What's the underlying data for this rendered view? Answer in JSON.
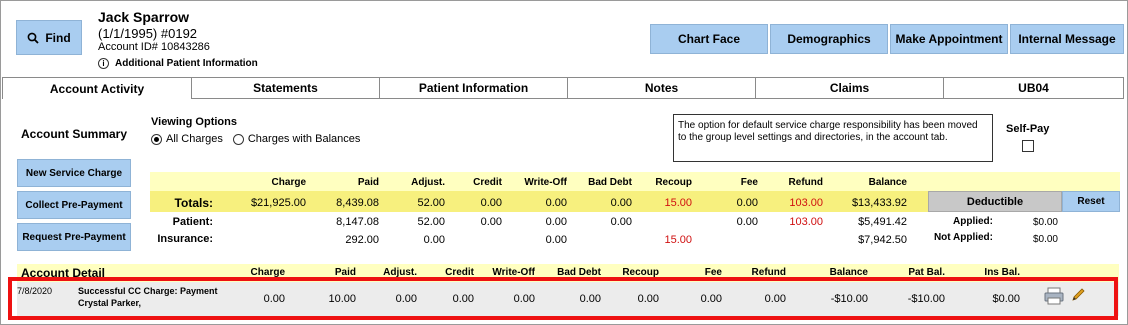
{
  "header": {
    "find_label": "Find",
    "patient_name": "Jack Sparrow",
    "patient_dob": "(1/1/1995) #0192",
    "account_id": "Account ID# 10843286",
    "additional_info": "Additional Patient Information",
    "buttons": [
      "Chart Face",
      "Demographics",
      "Make Appointment",
      "Internal Message"
    ]
  },
  "tabs": [
    "Account Activity",
    "Statements",
    "Patient Information",
    "Notes",
    "Claims",
    "UB04"
  ],
  "summary": {
    "title": "Account Summary",
    "viewing_options": "Viewing Options",
    "radio_all": "All Charges",
    "radio_balances": "Charges with Balances",
    "notice": "The option for default service charge responsibility has been moved to the group level settings and directories, in the account tab.",
    "self_pay": "Self-Pay",
    "side_buttons": [
      "New Service Charge",
      "Collect Pre-Payment",
      "Request Pre-Payment"
    ],
    "columns": [
      "Charge",
      "Paid",
      "Adjust.",
      "Credit",
      "Write-Off",
      "Bad Debt",
      "Recoup",
      "Fee",
      "Refund",
      "Balance"
    ],
    "totals_label": "Totals:",
    "totals": [
      "$21,925.00",
      "8,439.08",
      "52.00",
      "0.00",
      "0.00",
      "0.00",
      "15.00",
      "0.00",
      "103.00",
      "$13,433.92"
    ],
    "patient_label": "Patient:",
    "patient": [
      "",
      "8,147.08",
      "52.00",
      "0.00",
      "0.00",
      "0.00",
      "",
      "0.00",
      "103.00",
      "$5,491.42"
    ],
    "insurance_label": "Insurance:",
    "insurance": [
      "",
      "292.00",
      "0.00",
      "",
      "0.00",
      "",
      "15.00",
      "",
      "",
      "$7,942.50"
    ],
    "deductible": "Deductible",
    "reset": "Reset",
    "applied_label": "Applied:",
    "applied_value": "$0.00",
    "not_applied_label": "Not Applied:",
    "not_applied_value": "$0.00",
    "red_color": "#d01010"
  },
  "detail": {
    "title": "Account Detail",
    "columns": [
      "Charge",
      "Paid",
      "Adjust.",
      "Credit",
      "Write-Off",
      "Bad Debt",
      "Recoup",
      "Fee",
      "Refund",
      "Balance",
      "Pat Bal.",
      "Ins Bal."
    ],
    "row": {
      "date": "7/8/2020",
      "desc_line1": "Successful CC Charge: Payment",
      "desc_line2": "Crystal Parker,",
      "values": [
        "0.00",
        "10.00",
        "0.00",
        "0.00",
        "0.00",
        "0.00",
        "0.00",
        "0.00",
        "0.00",
        "-$10.00",
        "-$10.00",
        "$0.00"
      ]
    }
  }
}
